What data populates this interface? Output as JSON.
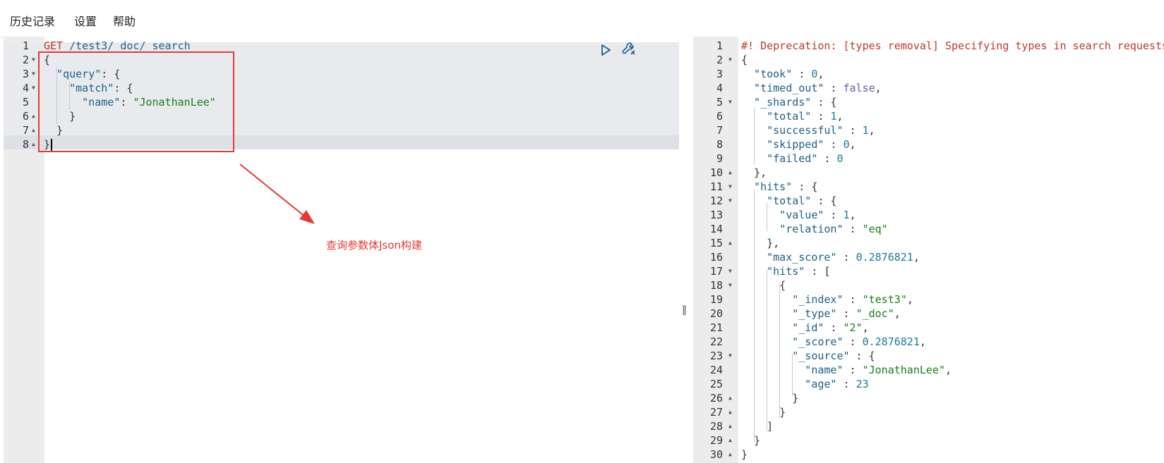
{
  "menu": [
    "历史记录",
    "设置",
    "帮助"
  ],
  "request": {
    "method": "GET",
    "url": "/test3/_doc/_search",
    "lines": [
      [
        {
          "t": "GET",
          "c": "method"
        },
        {
          "t": " "
        },
        {
          "t": "/test3/_doc/_search",
          "c": "url"
        }
      ],
      [
        {
          "t": "{",
          "c": "punct"
        }
      ],
      [
        {
          "t": "  \"query\"",
          "c": "key"
        },
        {
          "t": ": {",
          "c": "punct"
        }
      ],
      [
        {
          "t": "    \"match\"",
          "c": "key"
        },
        {
          "t": ": {",
          "c": "punct"
        }
      ],
      [
        {
          "t": "      \"name\"",
          "c": "key"
        },
        {
          "t": ": ",
          "c": "punct"
        },
        {
          "t": "\"JonathanLee\"",
          "c": "str"
        }
      ],
      [
        {
          "t": "    }",
          "c": "punct"
        }
      ],
      [
        {
          "t": "  }",
          "c": "punct"
        }
      ],
      [
        {
          "t": "}",
          "c": "punct"
        }
      ]
    ],
    "folds": [
      "",
      "down",
      "down",
      "down",
      "",
      "up",
      "up",
      "up"
    ]
  },
  "response": {
    "lines": [
      [
        {
          "t": "#! Deprecation: [types removal] Specifying types in search requests is deprecated.",
          "c": "warn"
        }
      ],
      [
        {
          "t": "{",
          "c": "punct"
        }
      ],
      [
        {
          "t": "  \"took\"",
          "c": "key"
        },
        {
          "t": " : ",
          "c": "punct"
        },
        {
          "t": "0",
          "c": "num"
        },
        {
          "t": ",",
          "c": "punct"
        }
      ],
      [
        {
          "t": "  \"timed_out\"",
          "c": "key"
        },
        {
          "t": " : ",
          "c": "punct"
        },
        {
          "t": "false",
          "c": "bool"
        },
        {
          "t": ",",
          "c": "punct"
        }
      ],
      [
        {
          "t": "  \"_shards\"",
          "c": "key"
        },
        {
          "t": " : {",
          "c": "punct"
        }
      ],
      [
        {
          "t": "    \"total\"",
          "c": "key"
        },
        {
          "t": " : ",
          "c": "punct"
        },
        {
          "t": "1",
          "c": "num"
        },
        {
          "t": ",",
          "c": "punct"
        }
      ],
      [
        {
          "t": "    \"successful\"",
          "c": "key"
        },
        {
          "t": " : ",
          "c": "punct"
        },
        {
          "t": "1",
          "c": "num"
        },
        {
          "t": ",",
          "c": "punct"
        }
      ],
      [
        {
          "t": "    \"skipped\"",
          "c": "key"
        },
        {
          "t": " : ",
          "c": "punct"
        },
        {
          "t": "0",
          "c": "num"
        },
        {
          "t": ",",
          "c": "punct"
        }
      ],
      [
        {
          "t": "    \"failed\"",
          "c": "key"
        },
        {
          "t": " : ",
          "c": "punct"
        },
        {
          "t": "0",
          "c": "num"
        }
      ],
      [
        {
          "t": "  },",
          "c": "punct"
        }
      ],
      [
        {
          "t": "  \"hits\"",
          "c": "key"
        },
        {
          "t": " : {",
          "c": "punct"
        }
      ],
      [
        {
          "t": "    \"total\"",
          "c": "key"
        },
        {
          "t": " : {",
          "c": "punct"
        }
      ],
      [
        {
          "t": "      \"value\"",
          "c": "key"
        },
        {
          "t": " : ",
          "c": "punct"
        },
        {
          "t": "1",
          "c": "num"
        },
        {
          "t": ",",
          "c": "punct"
        }
      ],
      [
        {
          "t": "      \"relation\"",
          "c": "key"
        },
        {
          "t": " : ",
          "c": "punct"
        },
        {
          "t": "\"eq\"",
          "c": "str"
        }
      ],
      [
        {
          "t": "    },",
          "c": "punct"
        }
      ],
      [
        {
          "t": "    \"max_score\"",
          "c": "key"
        },
        {
          "t": " : ",
          "c": "punct"
        },
        {
          "t": "0.2876821",
          "c": "num"
        },
        {
          "t": ",",
          "c": "punct"
        }
      ],
      [
        {
          "t": "    \"hits\"",
          "c": "key"
        },
        {
          "t": " : [",
          "c": "punct"
        }
      ],
      [
        {
          "t": "      {",
          "c": "punct"
        }
      ],
      [
        {
          "t": "        \"_index\"",
          "c": "key"
        },
        {
          "t": " : ",
          "c": "punct"
        },
        {
          "t": "\"test3\"",
          "c": "str"
        },
        {
          "t": ",",
          "c": "punct"
        }
      ],
      [
        {
          "t": "        \"_type\"",
          "c": "key"
        },
        {
          "t": " : ",
          "c": "punct"
        },
        {
          "t": "\"_doc\"",
          "c": "str"
        },
        {
          "t": ",",
          "c": "punct"
        }
      ],
      [
        {
          "t": "        \"_id\"",
          "c": "key"
        },
        {
          "t": " : ",
          "c": "punct"
        },
        {
          "t": "\"2\"",
          "c": "str"
        },
        {
          "t": ",",
          "c": "punct"
        }
      ],
      [
        {
          "t": "        \"_score\"",
          "c": "key"
        },
        {
          "t": " : ",
          "c": "punct"
        },
        {
          "t": "0.2876821",
          "c": "num"
        },
        {
          "t": ",",
          "c": "punct"
        }
      ],
      [
        {
          "t": "        \"_source\"",
          "c": "key"
        },
        {
          "t": " : {",
          "c": "punct"
        }
      ],
      [
        {
          "t": "          \"name\"",
          "c": "key"
        },
        {
          "t": " : ",
          "c": "punct"
        },
        {
          "t": "\"JonathanLee\"",
          "c": "str"
        },
        {
          "t": ",",
          "c": "punct"
        }
      ],
      [
        {
          "t": "          \"age\"",
          "c": "key"
        },
        {
          "t": " : ",
          "c": "punct"
        },
        {
          "t": "23",
          "c": "num"
        }
      ],
      [
        {
          "t": "        }",
          "c": "punct"
        }
      ],
      [
        {
          "t": "      }",
          "c": "punct"
        }
      ],
      [
        {
          "t": "    ]",
          "c": "punct"
        }
      ],
      [
        {
          "t": "  }",
          "c": "punct"
        }
      ],
      [
        {
          "t": "}",
          "c": "punct"
        }
      ]
    ],
    "folds": [
      "",
      "down",
      "",
      "",
      "down",
      "",
      "",
      "",
      "",
      "up",
      "down",
      "down",
      "",
      "",
      "up",
      "",
      "down",
      "down",
      "",
      "",
      "",
      "",
      "down",
      "",
      "",
      "up",
      "up",
      "up",
      "up",
      "up"
    ]
  },
  "annotation": "查询参数体Json构建",
  "colors": {
    "annotation": "#e53935",
    "play": "#1f5f88"
  },
  "icons": {
    "run": "play-icon",
    "settings": "wrench-icon",
    "splitter": "splitter-handle-icon"
  }
}
